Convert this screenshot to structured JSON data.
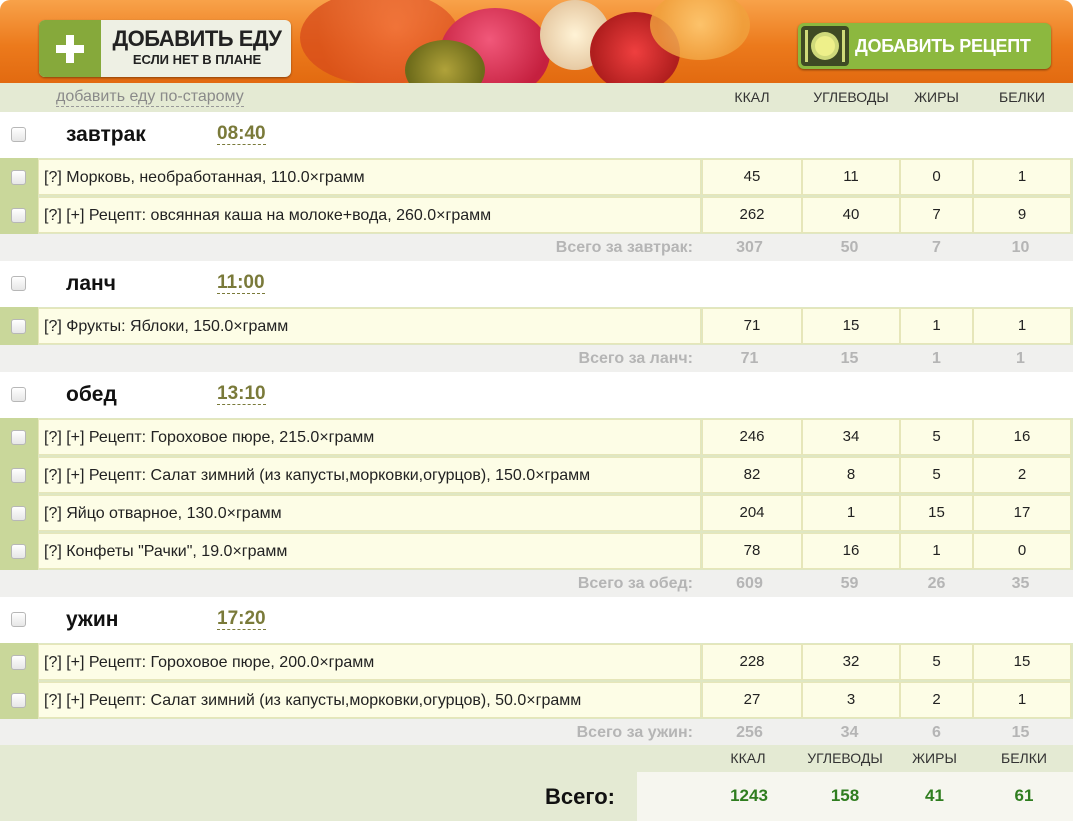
{
  "header": {
    "add_food_title": "ДОБАВИТЬ ЕДУ",
    "add_food_subtitle": "ЕСЛИ НЕТ В ПЛАНЕ",
    "add_recipe_label": "ДОБАВИТЬ РЕЦЕПТ",
    "old_way_link": "добавить еду по-старому"
  },
  "columns": [
    "ККАЛ",
    "УГЛЕВОДЫ",
    "ЖИРЫ",
    "БЕЛКИ"
  ],
  "meals": [
    {
      "name": "завтрак",
      "time": "08:40",
      "items": [
        {
          "name": "[?] Морковь, необработанная, 110.0×грамм",
          "kcal": "45",
          "carbs": "11",
          "fat": "0",
          "protein": "1"
        },
        {
          "name": "[?] [+] Рецепт: овсянная каша на молоке+вода, 260.0×грамм",
          "kcal": "262",
          "carbs": "40",
          "fat": "7",
          "protein": "9"
        }
      ],
      "total": {
        "label": "Всего за завтрак:",
        "kcal": "307",
        "carbs": "50",
        "fat": "7",
        "protein": "10"
      }
    },
    {
      "name": "ланч",
      "time": "11:00",
      "items": [
        {
          "name": "[?] Фрукты: Яблоки, 150.0×грамм",
          "kcal": "71",
          "carbs": "15",
          "fat": "1",
          "protein": "1"
        }
      ],
      "total": {
        "label": "Всего за ланч:",
        "kcal": "71",
        "carbs": "15",
        "fat": "1",
        "protein": "1"
      }
    },
    {
      "name": "обед",
      "time": "13:10",
      "items": [
        {
          "name": "[?] [+] Рецепт: Гороховое пюре, 215.0×грамм",
          "kcal": "246",
          "carbs": "34",
          "fat": "5",
          "protein": "16"
        },
        {
          "name": "[?] [+] Рецепт: Салат зимний (из капусты,морковки,огурцов), 150.0×грамм",
          "kcal": "82",
          "carbs": "8",
          "fat": "5",
          "protein": "2"
        },
        {
          "name": "[?] Яйцо отварное, 130.0×грамм",
          "kcal": "204",
          "carbs": "1",
          "fat": "15",
          "protein": "17"
        },
        {
          "name": "[?] Конфеты \"Рачки\", 19.0×грамм",
          "kcal": "78",
          "carbs": "16",
          "fat": "1",
          "protein": "0"
        }
      ],
      "total": {
        "label": "Всего за обед:",
        "kcal": "609",
        "carbs": "59",
        "fat": "26",
        "protein": "35"
      }
    },
    {
      "name": "ужин",
      "time": "17:20",
      "items": [
        {
          "name": "[?] [+] Рецепт: Гороховое пюре, 200.0×грамм",
          "kcal": "228",
          "carbs": "32",
          "fat": "5",
          "protein": "15"
        },
        {
          "name": "[?] [+] Рецепт: Салат зимний (из капусты,морковки,огурцов), 50.0×грамм",
          "kcal": "27",
          "carbs": "3",
          "fat": "2",
          "protein": "1"
        }
      ],
      "total": {
        "label": "Всего за ужин:",
        "kcal": "256",
        "carbs": "34",
        "fat": "6",
        "protein": "15"
      }
    }
  ],
  "grand_total": {
    "label": "Всего:",
    "columns": [
      "ККАЛ",
      "УГЛЕВОДЫ",
      "ЖИРЫ",
      "БЕЛКИ"
    ],
    "kcal": "1243",
    "carbs": "158",
    "fat": "41",
    "protein": "61"
  },
  "colors": {
    "banner_orange": "#ec7a1c",
    "accent_green": "#8cb83f",
    "row_light": "#fdfde6",
    "grand_value_green": "#2f7d1f"
  },
  "icons": [
    "plus-icon",
    "plate-icon",
    "fork-icon",
    "knife-icon",
    "checkbox"
  ]
}
